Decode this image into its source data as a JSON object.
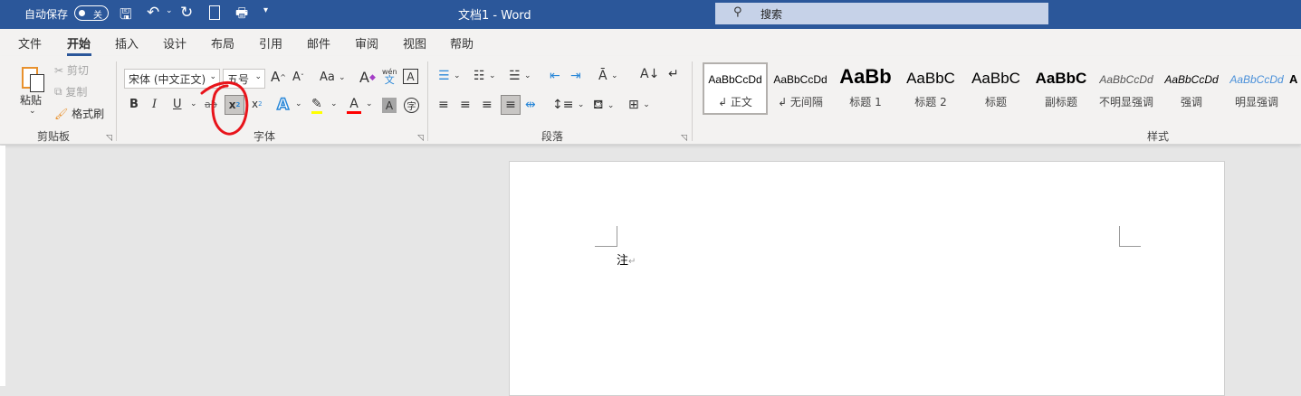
{
  "titlebar": {
    "autosave_label": "自动保存",
    "autosave_state": "关",
    "doc_title": "文档1  -  Word",
    "search_placeholder": "搜索",
    "color": "#2b579a"
  },
  "tabs": [
    "文件",
    "开始",
    "插入",
    "设计",
    "布局",
    "引用",
    "邮件",
    "审阅",
    "视图",
    "帮助"
  ],
  "active_tab": "开始",
  "clipboard": {
    "paste": "粘贴",
    "cut": "剪切",
    "copy": "复制",
    "format_painter": "格式刷",
    "label": "剪贴板"
  },
  "font": {
    "font_name": "宋体 (中文正文)",
    "font_size": "五号",
    "grow": "A",
    "shrink": "A",
    "change_case": "Aa",
    "phonetic_top": "wén",
    "phonetic_bottom": "文",
    "border_char": "A",
    "bold": "B",
    "italic": "I",
    "underline": "U",
    "strike": "ab",
    "subscript": "x",
    "subscript_small": "2",
    "superscript": "x",
    "superscript_small": "2",
    "text_effect": "A",
    "font_color": "A",
    "shading_char": "A",
    "enclose_char": "字",
    "label": "字体",
    "highlight_color": "#ffff00",
    "font_color_value": "#ff0000"
  },
  "paragraph": {
    "label": "段落"
  },
  "styles": {
    "label": "样式",
    "items": [
      {
        "preview": "AaBbCcDd",
        "name": "↲ 正文"
      },
      {
        "preview": "AaBbCcDd",
        "name": "↲ 无间隔"
      },
      {
        "preview": "AaBb",
        "name": "标题 1"
      },
      {
        "preview": "AaBbC",
        "name": "标题 2"
      },
      {
        "preview": "AaBbC",
        "name": "标题"
      },
      {
        "preview": "AaBbC",
        "name": "副标题"
      },
      {
        "preview": "AaBbCcDd",
        "name": "不明显强调"
      },
      {
        "preview": "AaBbCcDd",
        "name": "强调"
      },
      {
        "preview": "AaBbCcDd",
        "name": "明显强调"
      },
      {
        "preview": "A",
        "name": ""
      }
    ]
  },
  "document": {
    "text": "注",
    "mark": "↵"
  },
  "annotation_color": "#e8141b"
}
